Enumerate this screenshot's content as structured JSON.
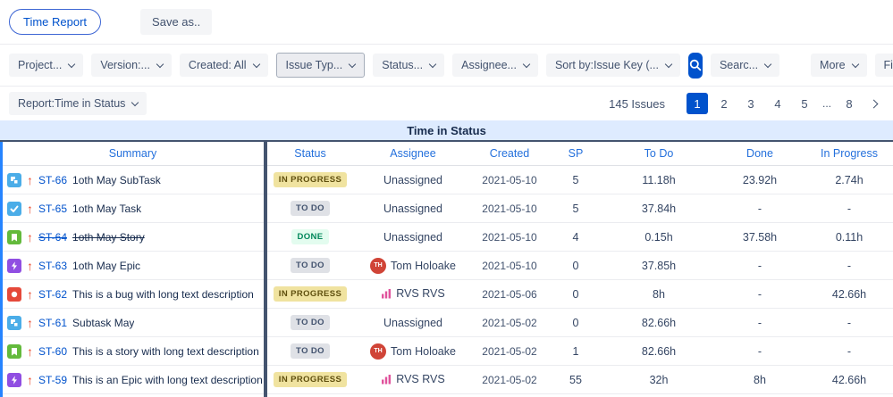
{
  "topbar": {
    "time_report_label": "Time Report",
    "save_as_label": "Save as.."
  },
  "filters": {
    "project": "Project...",
    "version": "Version:...",
    "created": "Created: All",
    "issue_type": "Issue Typ...",
    "status": "Status...",
    "assignee": "Assignee...",
    "sort": "Sort by:Issue Key (...",
    "search": "Searc...",
    "more": "More",
    "fields": "Fields"
  },
  "report_bar": {
    "selector": "Report:Time in Status",
    "issues_count": "145 Issues",
    "active_page": "1",
    "pages": [
      "1",
      "2",
      "3",
      "4",
      "5",
      "...",
      "8"
    ]
  },
  "table": {
    "band_title": "Time in Status",
    "columns": [
      "Summary",
      "Status",
      "Assignee",
      "Created",
      "SP",
      "To Do",
      "Done",
      "In Progress"
    ],
    "rows": [
      {
        "type": "subtask",
        "key": "ST-66",
        "summary": "1oth May SubTask",
        "status": "IN PROGRESS",
        "assignee": "Unassigned",
        "created": "2021-05-10",
        "sp": "5",
        "todo": "11.18h",
        "done": "23.92h",
        "in_progress": "2.74h"
      },
      {
        "type": "task",
        "key": "ST-65",
        "summary": "1oth May Task",
        "status": "TO DO",
        "assignee": "Unassigned",
        "created": "2021-05-10",
        "sp": "5",
        "todo": "37.84h",
        "done": "-",
        "in_progress": "-"
      },
      {
        "type": "story",
        "key": "ST-64",
        "summary": "1oth May Story",
        "status": "DONE",
        "assignee": "Unassigned",
        "created": "2021-05-10",
        "sp": "4",
        "todo": "0.15h",
        "done": "37.58h",
        "in_progress": "0.11h",
        "resolved": true
      },
      {
        "type": "epic",
        "key": "ST-63",
        "summary": "1oth May Epic",
        "status": "TO DO",
        "assignee": "Tom Holoake",
        "avatar": "TH",
        "created": "2021-05-10",
        "sp": "0",
        "todo": "37.85h",
        "done": "-",
        "in_progress": "-"
      },
      {
        "type": "bug",
        "key": "ST-62",
        "summary": "This is a bug with long text description",
        "status": "IN PROGRESS",
        "assignee": "RVS RVS",
        "created": "2021-05-06",
        "sp": "0",
        "todo": "8h",
        "done": "-",
        "in_progress": "42.66h"
      },
      {
        "type": "subtask",
        "key": "ST-61",
        "summary": "Subtask May",
        "status": "TO DO",
        "assignee": "Unassigned",
        "created": "2021-05-02",
        "sp": "0",
        "todo": "82.66h",
        "done": "-",
        "in_progress": "-"
      },
      {
        "type": "story",
        "key": "ST-60",
        "summary": "This is a story with long text description",
        "status": "TO DO",
        "assignee": "Tom Holoake",
        "avatar": "TH",
        "created": "2021-05-02",
        "sp": "1",
        "todo": "82.66h",
        "done": "-",
        "in_progress": "-"
      },
      {
        "type": "epic",
        "key": "ST-59",
        "summary": "This is an Epic with long text description",
        "status": "IN PROGRESS",
        "assignee": "RVS RVS",
        "created": "2021-05-02",
        "sp": "55",
        "todo": "32h",
        "done": "8h",
        "in_progress": "42.66h"
      }
    ]
  },
  "colors": {
    "accent_blue": "#0052CC",
    "band_bg": "#DEEBFF",
    "header_text": "#2470DC",
    "status_inprogress_bg": "#F0E3A0",
    "status_todo_bg": "#DFE1E6",
    "status_done_bg": "#E3FCEF",
    "priority_up": "#E9492B",
    "subtask_icon": "#4BADE8",
    "task_icon": "#4BADE8",
    "story_icon": "#63BA3C",
    "epic_icon": "#904EE2",
    "bug_icon": "#E5493A"
  },
  "icons": {
    "search": "magnifier",
    "chevron": "chevron-down",
    "next_page": "chevron-right",
    "priority_up": "up-arrow"
  }
}
